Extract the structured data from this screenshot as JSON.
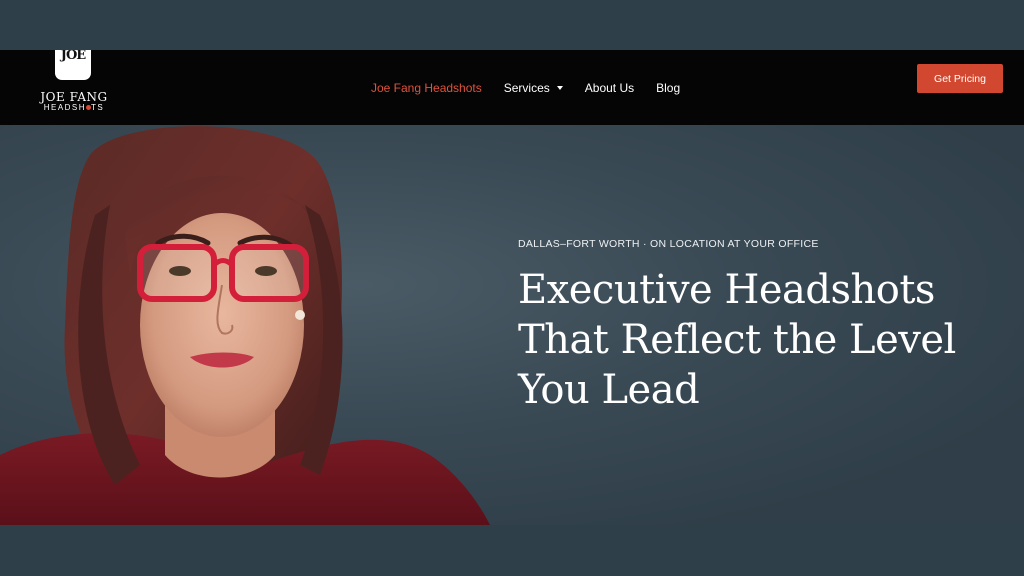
{
  "brand": {
    "badge_text": "JOE",
    "line1": "JOE FANG",
    "line2_prefix": "HEADSH",
    "line2_suffix": "TS"
  },
  "nav": {
    "items": [
      {
        "label": "Joe Fang Headshots"
      },
      {
        "label": "Services"
      },
      {
        "label": "About Us"
      },
      {
        "label": "Blog"
      }
    ],
    "cta_label": "Get Pricing"
  },
  "hero": {
    "eyebrow": "DALLAS–FORT WORTH · ON LOCATION AT YOUR OFFICE",
    "headline_lines": [
      "Executive Headshots",
      "That Reflect the Level",
      "You Lead"
    ]
  },
  "colors": {
    "accent": "#d2472f",
    "nav_background": "#050505",
    "hero_background": "#2f3f49",
    "active_link": "#e0523b"
  }
}
